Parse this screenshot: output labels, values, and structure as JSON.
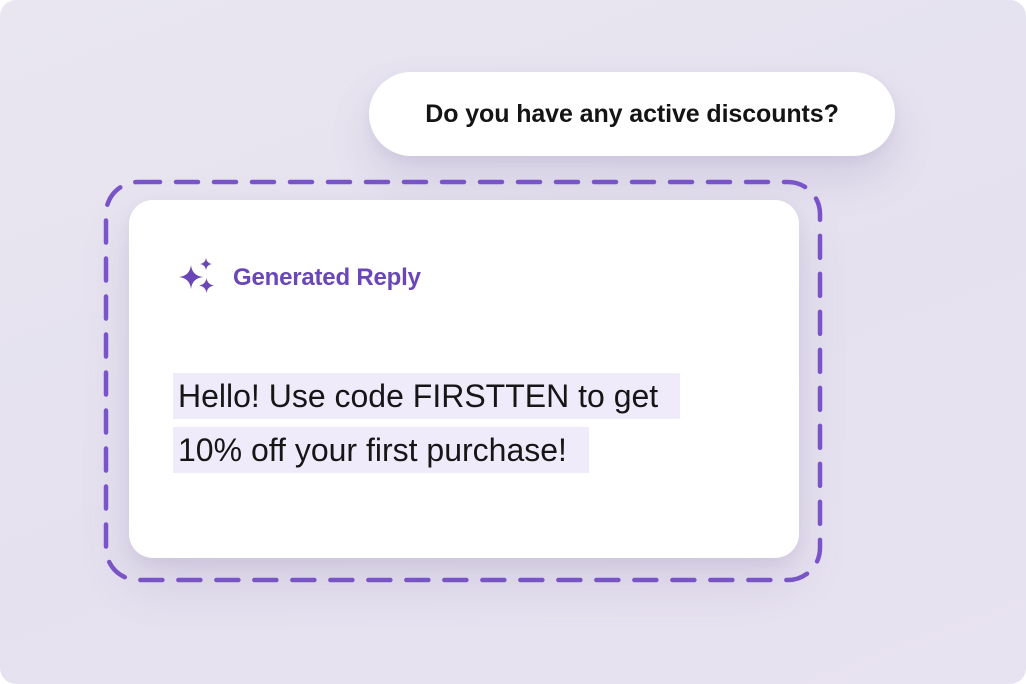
{
  "user_message": {
    "text": "Do you have any active discounts?"
  },
  "generated_reply": {
    "header_label": "Generated Reply",
    "header_icon": "sparkles-icon",
    "lines": [
      "Hello! Use code FIRSTTEN to get",
      "10% off your first purchase!"
    ]
  },
  "colors": {
    "accent": "#6a46b8",
    "dashed_border": "#7a55c9",
    "highlight": "#efebfb",
    "background": "#e7e3f0"
  }
}
